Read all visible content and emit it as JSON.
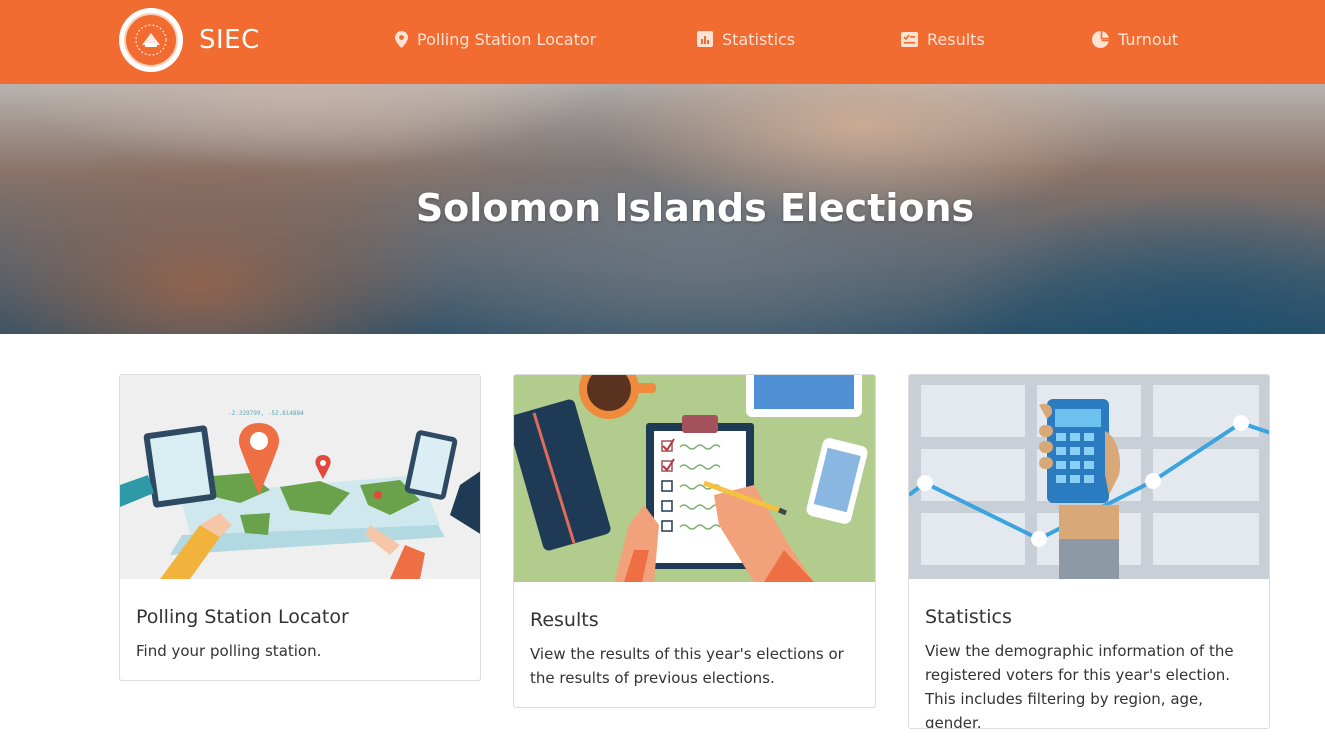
{
  "brand": {
    "name": "SIEC"
  },
  "nav": {
    "polling_station_locator": "Polling Station Locator",
    "statistics": "Statistics",
    "results": "Results",
    "turnout": "Turnout"
  },
  "hero": {
    "title": "Solomon Islands Elections"
  },
  "cards": [
    {
      "title": "Polling Station Locator",
      "text": "Find your polling station."
    },
    {
      "title": "Results",
      "text": "View the results of this year's elections or the results of previous elections."
    },
    {
      "title": "Statistics",
      "text": "View the demographic information of the registered voters for this year's election. This includes filtering by region, age, gender."
    }
  ],
  "illustration": {
    "map_coords": "-2.329799, -52.814884"
  },
  "colors": {
    "brand_orange": "#f26b31",
    "nav_text": "#fde3d4"
  },
  "icons": {
    "locator": "map-marker-icon",
    "statistics": "bar-chart-icon",
    "results": "checklist-icon",
    "turnout": "pie-chart-icon"
  }
}
